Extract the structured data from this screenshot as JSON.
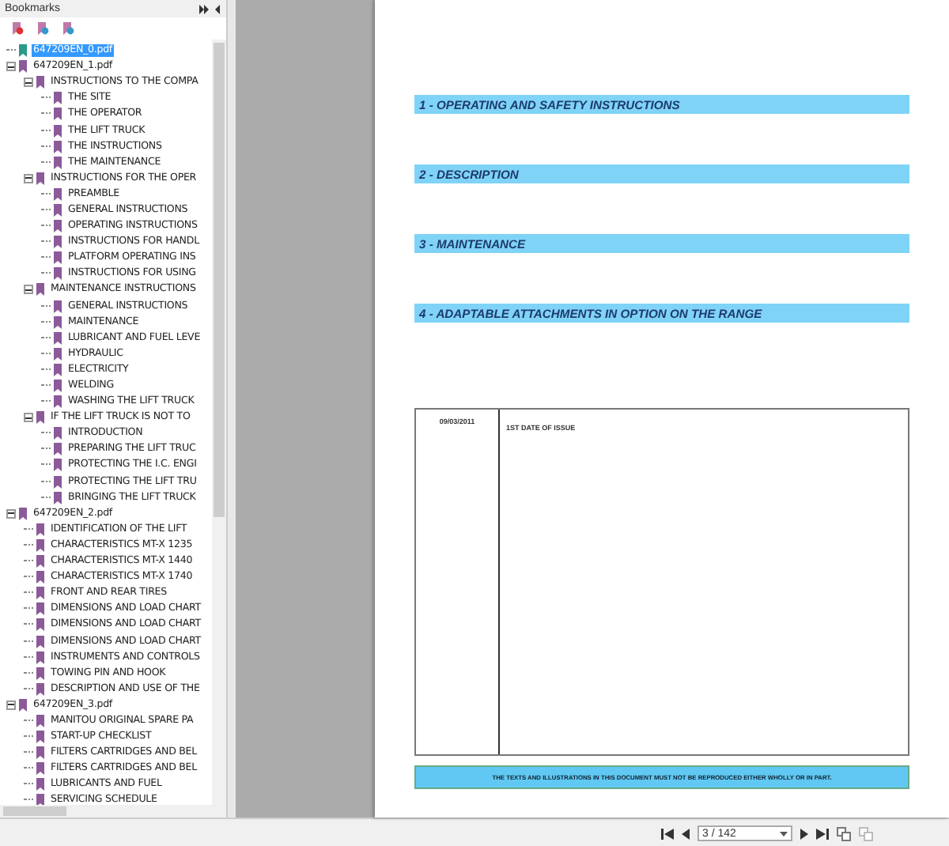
{
  "panel": {
    "title": "Bookmarks"
  },
  "bookmarks": [
    {
      "label": "647209EN_0.pdf",
      "selected": true
    },
    {
      "label": "647209EN_1.pdf",
      "selected": false,
      "expanded": true,
      "children": [
        {
          "label": "INSTRUCTIONS TO THE COMPA",
          "selected": false,
          "expanded": true,
          "children": [
            {
              "label": "THE SITE",
              "selected": false
            },
            {
              "label": "THE OPERATOR",
              "selected": false
            },
            {
              "label": "THE LIFT TRUCK",
              "selected": false
            },
            {
              "label": "THE INSTRUCTIONS",
              "selected": false
            },
            {
              "label": "THE MAINTENANCE",
              "selected": false
            }
          ]
        },
        {
          "label": "INSTRUCTIONS FOR THE OPER",
          "selected": false,
          "expanded": true,
          "children": [
            {
              "label": "PREAMBLE",
              "selected": false
            },
            {
              "label": "GENERAL INSTRUCTIONS",
              "selected": false
            },
            {
              "label": "OPERATING INSTRUCTIONS",
              "selected": false
            },
            {
              "label": "INSTRUCTIONS FOR HANDL",
              "selected": false
            },
            {
              "label": "PLATFORM OPERATING INS",
              "selected": false
            },
            {
              "label": "INSTRUCTIONS FOR USING",
              "selected": false
            }
          ]
        },
        {
          "label": "MAINTENANCE INSTRUCTIONS",
          "selected": false,
          "expanded": true,
          "children": [
            {
              "label": "GENERAL INSTRUCTIONS",
              "selected": false
            },
            {
              "label": "MAINTENANCE",
              "selected": false
            },
            {
              "label": "LUBRICANT AND FUEL LEVE",
              "selected": false
            },
            {
              "label": "HYDRAULIC",
              "selected": false
            },
            {
              "label": "ELECTRICITY",
              "selected": false
            },
            {
              "label": "WELDING",
              "selected": false
            },
            {
              "label": "WASHING THE LIFT TRUCK",
              "selected": false
            }
          ]
        },
        {
          "label": "IF THE LIFT TRUCK IS NOT TO",
          "selected": false,
          "expanded": true,
          "children": [
            {
              "label": "INTRODUCTION",
              "selected": false
            },
            {
              "label": "PREPARING THE LIFT TRUC",
              "selected": false
            },
            {
              "label": "PROTECTING THE I.C. ENGI",
              "selected": false
            },
            {
              "label": "PROTECTING THE LIFT TRU",
              "selected": false
            },
            {
              "label": "BRINGING THE LIFT TRUCK",
              "selected": false
            }
          ]
        }
      ]
    },
    {
      "label": "647209EN_2.pdf",
      "selected": false,
      "expanded": true,
      "children": [
        {
          "label": "IDENTIFICATION OF THE LIFT",
          "selected": false
        },
        {
          "label": "CHARACTERISTICS MT-X 1235",
          "selected": false
        },
        {
          "label": "CHARACTERISTICS MT-X 1440",
          "selected": false
        },
        {
          "label": "CHARACTERISTICS MT-X 1740",
          "selected": false
        },
        {
          "label": "FRONT AND REAR TIRES",
          "selected": false
        },
        {
          "label": "DIMENSIONS AND LOAD CHART",
          "selected": false
        },
        {
          "label": "DIMENSIONS AND LOAD CHART",
          "selected": false
        },
        {
          "label": "DIMENSIONS AND LOAD CHART",
          "selected": false
        },
        {
          "label": "INSTRUMENTS AND CONTROLS",
          "selected": false
        },
        {
          "label": "TOWING PIN AND HOOK",
          "selected": false
        },
        {
          "label": "DESCRIPTION AND USE OF THE",
          "selected": false
        }
      ]
    },
    {
      "label": "647209EN_3.pdf",
      "selected": false,
      "expanded": true,
      "children": [
        {
          "label": "MANITOU ORIGINAL SPARE PA",
          "selected": false
        },
        {
          "label": "START-UP CHECKLIST",
          "selected": false
        },
        {
          "label": "FILTERS CARTRIDGES AND BEL",
          "selected": false
        },
        {
          "label": "FILTERS CARTRIDGES AND BEL",
          "selected": false
        },
        {
          "label": "LUBRICANTS AND FUEL",
          "selected": false
        },
        {
          "label": "SERVICING SCHEDULE",
          "selected": false
        }
      ]
    }
  ],
  "page": {
    "sections": [
      "1 - OPERATING AND SAFETY INSTRUCTIONS",
      "2 - DESCRIPTION",
      "3 - MAINTENANCE",
      "4 - ADAPTABLE ATTACHMENTS IN OPTION ON THE RANGE"
    ],
    "revision_table": {
      "date": "09/03/2011",
      "description": "1ST DATE OF ISSUE"
    },
    "footer_notice": "THE TEXTS AND ILLUSTRATIONS IN THIS DOCUMENT MUST NOT BE REPRODUCED EITHER WHOLLY OR IN PART."
  },
  "navigation": {
    "page_field": "3 / 142"
  }
}
